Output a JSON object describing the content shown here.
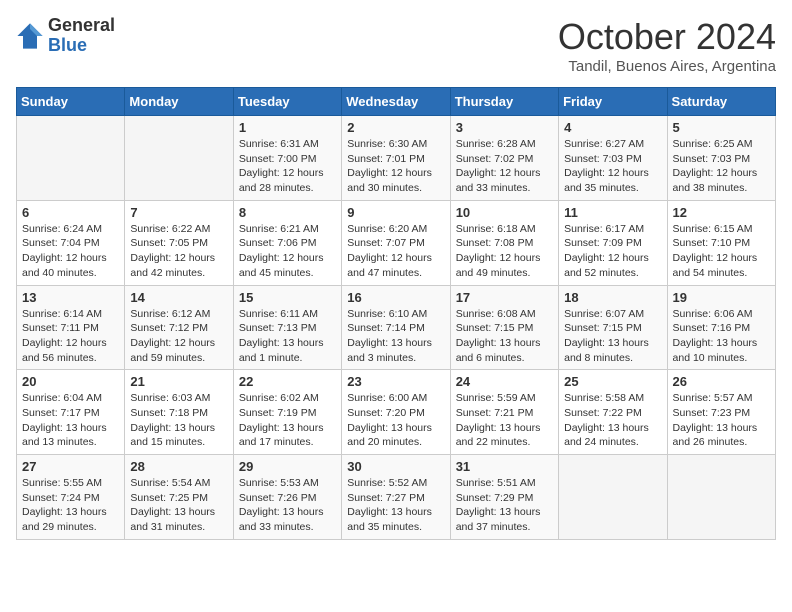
{
  "logo": {
    "general": "General",
    "blue": "Blue"
  },
  "title": "October 2024",
  "subtitle": "Tandil, Buenos Aires, Argentina",
  "days_of_week": [
    "Sunday",
    "Monday",
    "Tuesday",
    "Wednesday",
    "Thursday",
    "Friday",
    "Saturday"
  ],
  "weeks": [
    [
      {
        "day": "",
        "info": ""
      },
      {
        "day": "",
        "info": ""
      },
      {
        "day": "1",
        "sunrise": "Sunrise: 6:31 AM",
        "sunset": "Sunset: 7:00 PM",
        "daylight": "Daylight: 12 hours and 28 minutes."
      },
      {
        "day": "2",
        "sunrise": "Sunrise: 6:30 AM",
        "sunset": "Sunset: 7:01 PM",
        "daylight": "Daylight: 12 hours and 30 minutes."
      },
      {
        "day": "3",
        "sunrise": "Sunrise: 6:28 AM",
        "sunset": "Sunset: 7:02 PM",
        "daylight": "Daylight: 12 hours and 33 minutes."
      },
      {
        "day": "4",
        "sunrise": "Sunrise: 6:27 AM",
        "sunset": "Sunset: 7:03 PM",
        "daylight": "Daylight: 12 hours and 35 minutes."
      },
      {
        "day": "5",
        "sunrise": "Sunrise: 6:25 AM",
        "sunset": "Sunset: 7:03 PM",
        "daylight": "Daylight: 12 hours and 38 minutes."
      }
    ],
    [
      {
        "day": "6",
        "sunrise": "Sunrise: 6:24 AM",
        "sunset": "Sunset: 7:04 PM",
        "daylight": "Daylight: 12 hours and 40 minutes."
      },
      {
        "day": "7",
        "sunrise": "Sunrise: 6:22 AM",
        "sunset": "Sunset: 7:05 PM",
        "daylight": "Daylight: 12 hours and 42 minutes."
      },
      {
        "day": "8",
        "sunrise": "Sunrise: 6:21 AM",
        "sunset": "Sunset: 7:06 PM",
        "daylight": "Daylight: 12 hours and 45 minutes."
      },
      {
        "day": "9",
        "sunrise": "Sunrise: 6:20 AM",
        "sunset": "Sunset: 7:07 PM",
        "daylight": "Daylight: 12 hours and 47 minutes."
      },
      {
        "day": "10",
        "sunrise": "Sunrise: 6:18 AM",
        "sunset": "Sunset: 7:08 PM",
        "daylight": "Daylight: 12 hours and 49 minutes."
      },
      {
        "day": "11",
        "sunrise": "Sunrise: 6:17 AM",
        "sunset": "Sunset: 7:09 PM",
        "daylight": "Daylight: 12 hours and 52 minutes."
      },
      {
        "day": "12",
        "sunrise": "Sunrise: 6:15 AM",
        "sunset": "Sunset: 7:10 PM",
        "daylight": "Daylight: 12 hours and 54 minutes."
      }
    ],
    [
      {
        "day": "13",
        "sunrise": "Sunrise: 6:14 AM",
        "sunset": "Sunset: 7:11 PM",
        "daylight": "Daylight: 12 hours and 56 minutes."
      },
      {
        "day": "14",
        "sunrise": "Sunrise: 6:12 AM",
        "sunset": "Sunset: 7:12 PM",
        "daylight": "Daylight: 12 hours and 59 minutes."
      },
      {
        "day": "15",
        "sunrise": "Sunrise: 6:11 AM",
        "sunset": "Sunset: 7:13 PM",
        "daylight": "Daylight: 13 hours and 1 minute."
      },
      {
        "day": "16",
        "sunrise": "Sunrise: 6:10 AM",
        "sunset": "Sunset: 7:14 PM",
        "daylight": "Daylight: 13 hours and 3 minutes."
      },
      {
        "day": "17",
        "sunrise": "Sunrise: 6:08 AM",
        "sunset": "Sunset: 7:15 PM",
        "daylight": "Daylight: 13 hours and 6 minutes."
      },
      {
        "day": "18",
        "sunrise": "Sunrise: 6:07 AM",
        "sunset": "Sunset: 7:15 PM",
        "daylight": "Daylight: 13 hours and 8 minutes."
      },
      {
        "day": "19",
        "sunrise": "Sunrise: 6:06 AM",
        "sunset": "Sunset: 7:16 PM",
        "daylight": "Daylight: 13 hours and 10 minutes."
      }
    ],
    [
      {
        "day": "20",
        "sunrise": "Sunrise: 6:04 AM",
        "sunset": "Sunset: 7:17 PM",
        "daylight": "Daylight: 13 hours and 13 minutes."
      },
      {
        "day": "21",
        "sunrise": "Sunrise: 6:03 AM",
        "sunset": "Sunset: 7:18 PM",
        "daylight": "Daylight: 13 hours and 15 minutes."
      },
      {
        "day": "22",
        "sunrise": "Sunrise: 6:02 AM",
        "sunset": "Sunset: 7:19 PM",
        "daylight": "Daylight: 13 hours and 17 minutes."
      },
      {
        "day": "23",
        "sunrise": "Sunrise: 6:00 AM",
        "sunset": "Sunset: 7:20 PM",
        "daylight": "Daylight: 13 hours and 20 minutes."
      },
      {
        "day": "24",
        "sunrise": "Sunrise: 5:59 AM",
        "sunset": "Sunset: 7:21 PM",
        "daylight": "Daylight: 13 hours and 22 minutes."
      },
      {
        "day": "25",
        "sunrise": "Sunrise: 5:58 AM",
        "sunset": "Sunset: 7:22 PM",
        "daylight": "Daylight: 13 hours and 24 minutes."
      },
      {
        "day": "26",
        "sunrise": "Sunrise: 5:57 AM",
        "sunset": "Sunset: 7:23 PM",
        "daylight": "Daylight: 13 hours and 26 minutes."
      }
    ],
    [
      {
        "day": "27",
        "sunrise": "Sunrise: 5:55 AM",
        "sunset": "Sunset: 7:24 PM",
        "daylight": "Daylight: 13 hours and 29 minutes."
      },
      {
        "day": "28",
        "sunrise": "Sunrise: 5:54 AM",
        "sunset": "Sunset: 7:25 PM",
        "daylight": "Daylight: 13 hours and 31 minutes."
      },
      {
        "day": "29",
        "sunrise": "Sunrise: 5:53 AM",
        "sunset": "Sunset: 7:26 PM",
        "daylight": "Daylight: 13 hours and 33 minutes."
      },
      {
        "day": "30",
        "sunrise": "Sunrise: 5:52 AM",
        "sunset": "Sunset: 7:27 PM",
        "daylight": "Daylight: 13 hours and 35 minutes."
      },
      {
        "day": "31",
        "sunrise": "Sunrise: 5:51 AM",
        "sunset": "Sunset: 7:29 PM",
        "daylight": "Daylight: 13 hours and 37 minutes."
      },
      {
        "day": "",
        "info": ""
      },
      {
        "day": "",
        "info": ""
      }
    ]
  ]
}
